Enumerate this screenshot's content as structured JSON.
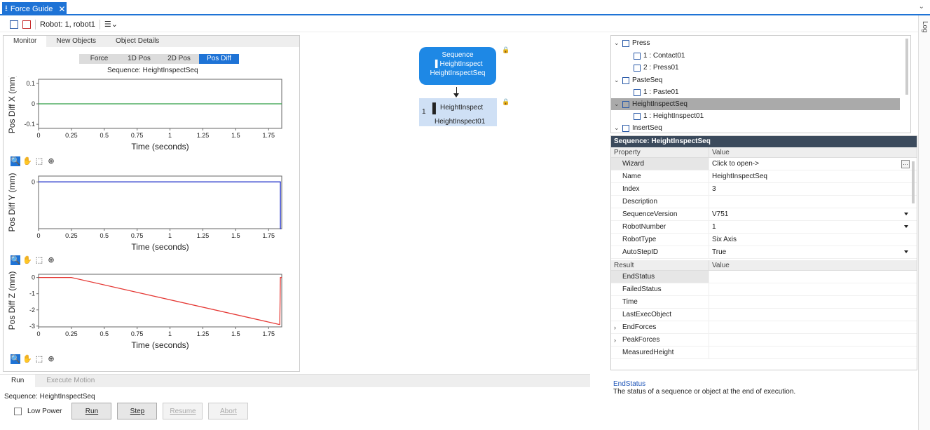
{
  "window": {
    "tab_title": "Force Guide",
    "robot_label": "Robot: 1, robot1",
    "log_label": "Log"
  },
  "left": {
    "tabs": [
      "Monitor",
      "New Objects",
      "Object Details"
    ],
    "view_buttons": [
      "Force",
      "1D Pos",
      "2D Pos",
      "Pos Diff"
    ],
    "active_view": "Pos Diff",
    "sequence_caption": "Sequence: HeightInspectSeq"
  },
  "chart_data": [
    {
      "type": "line",
      "title": "",
      "xlabel": "Time (seconds)",
      "ylabel": "Pos Diff X (mm)",
      "xlim": [
        0,
        1.85
      ],
      "ylim": [
        -0.12,
        0.12
      ],
      "x_ticks": [
        "0",
        "0.25",
        "0.5",
        "0.75",
        "1",
        "1.25",
        "1.5",
        "1.75"
      ],
      "y_ticks": [
        "0.1",
        "0",
        "-0.1"
      ],
      "color": "#2e9e44",
      "series": [
        {
          "x": [
            0,
            1.85
          ],
          "y": [
            0,
            0
          ]
        }
      ]
    },
    {
      "type": "line",
      "title": "",
      "xlabel": "Time (seconds)",
      "ylabel": "Pos Diff Y (mm)",
      "xlim": [
        0,
        1.85
      ],
      "ylim": [
        -0.4,
        0.05
      ],
      "x_ticks": [
        "0",
        "0.25",
        "0.5",
        "0.75",
        "1",
        "1.25",
        "1.5",
        "1.75"
      ],
      "y_ticks": [
        "0"
      ],
      "color": "#1f2fc8",
      "series": [
        {
          "x": [
            0,
            1.84,
            1.84,
            1.845
          ],
          "y": [
            0,
            0,
            -0.4,
            -0.4
          ]
        }
      ]
    },
    {
      "type": "line",
      "title": "",
      "xlabel": "Time (seconds)",
      "ylabel": "Pos Diff Z (mm)",
      "xlim": [
        0,
        1.85
      ],
      "ylim": [
        -3.05,
        0.2
      ],
      "x_ticks": [
        "0",
        "0.25",
        "0.5",
        "0.75",
        "1",
        "1.25",
        "1.5",
        "1.75"
      ],
      "y_ticks": [
        "0",
        "-1",
        "-2",
        "-3"
      ],
      "color": "#e53935",
      "series": [
        {
          "x": [
            0,
            0.25,
            1.83,
            1.835,
            1.84,
            1.85
          ],
          "y": [
            0,
            0,
            -2.9,
            -2.9,
            0,
            0
          ]
        }
      ]
    }
  ],
  "chart_tools": [
    "zoom-icon",
    "pan-icon",
    "select-icon",
    "zoom-fit-icon"
  ],
  "flow": {
    "sequence_label": "Sequence",
    "sequence_obj_label": "HeightInspect",
    "sequence_name": "HeightInspectSeq",
    "object_index": "1",
    "object_label": "HeightInspect",
    "object_name": "HeightInspect01"
  },
  "tree": {
    "items": [
      {
        "level": 0,
        "label": "Press"
      },
      {
        "level": 1,
        "label": "1 : Contact01"
      },
      {
        "level": 1,
        "label": "2 : Press01"
      },
      {
        "level": 0,
        "label": "PasteSeq"
      },
      {
        "level": 1,
        "label": "1 : Paste01"
      },
      {
        "level": 0,
        "label": "HeightInspectSeq",
        "selected": true
      },
      {
        "level": 1,
        "label": "1 : HeightInspect01"
      },
      {
        "level": 0,
        "label": "InsertSeq"
      }
    ]
  },
  "props": {
    "title": "Sequence: HeightInspectSeq",
    "col_property": "Property",
    "col_value": "Value",
    "rows": [
      {
        "name": "Wizard",
        "value": "Click to open->",
        "ellipsis": true
      },
      {
        "name": "Name",
        "value": "HeightInspectSeq"
      },
      {
        "name": "Index",
        "value": "3"
      },
      {
        "name": "Description",
        "value": ""
      },
      {
        "name": "SequenceVersion",
        "value": "V751",
        "dropdown": true
      },
      {
        "name": "RobotNumber",
        "value": "1",
        "dropdown": true
      },
      {
        "name": "RobotType",
        "value": "Six Axis"
      },
      {
        "name": "AutoStepID",
        "value": "True",
        "dropdown": true
      }
    ],
    "col_result": "Result",
    "col_result_value": "Value",
    "results": [
      {
        "name": "EndStatus",
        "value": "",
        "highlight": true
      },
      {
        "name": "FailedStatus",
        "value": ""
      },
      {
        "name": "Time",
        "value": ""
      },
      {
        "name": "LastExecObject",
        "value": ""
      },
      {
        "name": "EndForces",
        "value": "",
        "expandable": true
      },
      {
        "name": "PeakForces",
        "value": "",
        "expandable": true
      },
      {
        "name": "MeasuredHeight",
        "value": ""
      }
    ]
  },
  "description": {
    "title": "EndStatus",
    "text": "The status of a sequence or object at the end of execution."
  },
  "run": {
    "tabs": [
      "Run",
      "Execute Motion"
    ],
    "sequence": "Sequence: HeightInspectSeq",
    "low_power": "Low Power",
    "buttons": {
      "run": "Run",
      "step": "Step",
      "resume": "Resume",
      "abort": "Abort"
    }
  }
}
